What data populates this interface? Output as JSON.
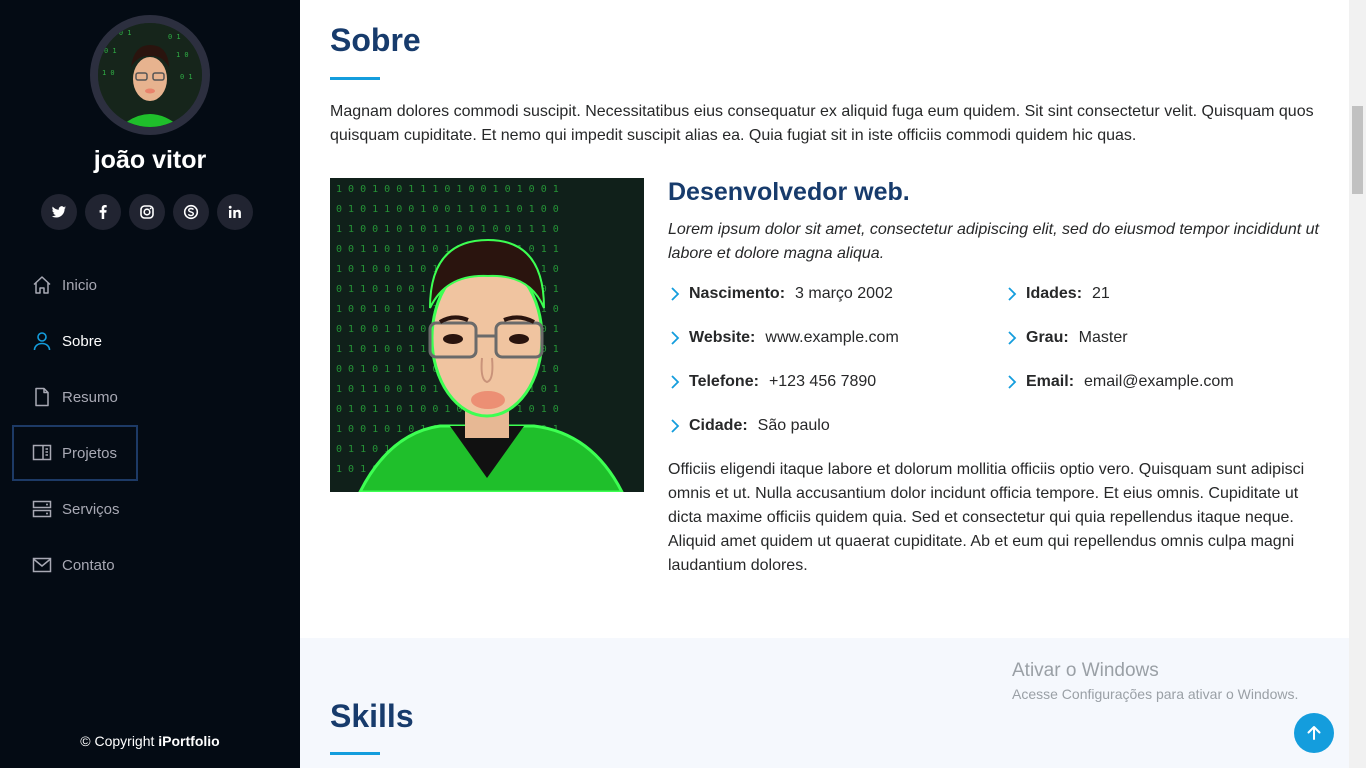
{
  "sidebar": {
    "profile_name": "joão vitor",
    "social": [
      {
        "icon": "twitter-icon"
      },
      {
        "icon": "facebook-icon"
      },
      {
        "icon": "instagram-icon"
      },
      {
        "icon": "skype-icon"
      },
      {
        "icon": "linkedin-icon"
      }
    ],
    "nav": [
      {
        "label": "Inicio",
        "icon": "home-icon"
      },
      {
        "label": "Sobre",
        "icon": "person-icon"
      },
      {
        "label": "Resumo",
        "icon": "file-icon"
      },
      {
        "label": "Projetos",
        "icon": "book-icon"
      },
      {
        "label": "Serviços",
        "icon": "server-icon"
      },
      {
        "label": "Contato",
        "icon": "envelope-icon"
      }
    ],
    "copyright_prefix": "© Copyright",
    "copyright_brand": "iPortfolio"
  },
  "about": {
    "title": "Sobre",
    "intro": "Magnam dolores commodi suscipit. Necessitatibus eius consequatur ex aliquid fuga eum quidem. Sit sint consectetur velit. Quisquam quos quisquam cupiditate. Et nemo qui impedit suscipit alias ea. Quia fugiat sit in iste officiis commodi quidem hic quas.",
    "role_title": "Desenvolvedor web.",
    "role_desc": "Lorem ipsum dolor sit amet, consectetur adipiscing elit, sed do eiusmod tempor incididunt ut labore et dolore magna aliqua.",
    "info_left": [
      {
        "label": "Nascimento:",
        "value": "3 março 2002"
      },
      {
        "label": "Website:",
        "value": "www.example.com"
      },
      {
        "label": "Telefone:",
        "value": "+123 456 7890"
      },
      {
        "label": "Cidade:",
        "value": "São paulo"
      }
    ],
    "info_right": [
      {
        "label": "Idades:",
        "value": "21"
      },
      {
        "label": "Grau:",
        "value": "Master"
      },
      {
        "label": "Email:",
        "value": "email@example.com"
      }
    ],
    "body": "Officiis eligendi itaque labore et dolorum mollitia officiis optio vero. Quisquam sunt adipisci omnis et ut. Nulla accusantium dolor incidunt officia tempore. Et eius omnis. Cupiditate ut dicta maxime officiis quidem quia. Sed et consectetur qui quia repellendus itaque neque. Aliquid amet quidem ut quaerat cupiditate. Ab et eum qui repellendus omnis culpa magni laudantium dolores."
  },
  "skills": {
    "title": "Skills"
  },
  "watermark": {
    "line1": "Ativar o Windows",
    "line2": "Acesse Configurações para ativar o Windows."
  },
  "colors": {
    "accent": "#149ddd",
    "heading": "#173b6c",
    "sidebar_bg": "#040b14"
  }
}
